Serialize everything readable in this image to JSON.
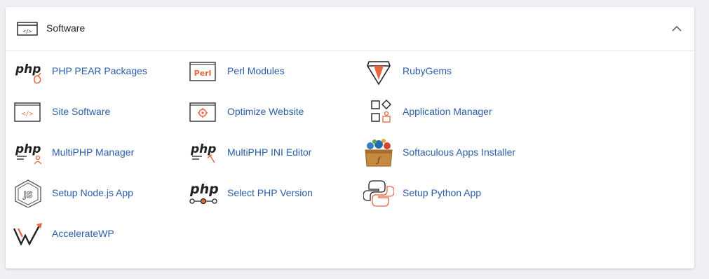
{
  "section": {
    "title": "Software",
    "items": [
      {
        "label": "PHP PEAR Packages",
        "icon": "php-pear-icon"
      },
      {
        "label": "Perl Modules",
        "icon": "perl-icon"
      },
      {
        "label": "RubyGems",
        "icon": "rubygems-icon"
      },
      {
        "label": "Site Software",
        "icon": "code-window-icon"
      },
      {
        "label": "Optimize Website",
        "icon": "gear-window-icon"
      },
      {
        "label": "Application Manager",
        "icon": "app-shapes-icon"
      },
      {
        "label": "MultiPHP Manager",
        "icon": "php-user-icon"
      },
      {
        "label": "MultiPHP INI Editor",
        "icon": "php-edit-icon"
      },
      {
        "label": "Softaculous Apps Installer",
        "icon": "softaculous-box-icon"
      },
      {
        "label": "Setup Node.js App",
        "icon": "nodejs-icon"
      },
      {
        "label": "Select PHP Version",
        "icon": "php-slider-icon"
      },
      {
        "label": "Setup Python App",
        "icon": "python-icon"
      },
      {
        "label": "AccelerateWP",
        "icon": "acceleratewp-icon"
      }
    ],
    "icon_texts": {
      "php": "php",
      "perl": "Perl",
      "js": "JS"
    }
  },
  "colors": {
    "accent": "#e8663d",
    "link": "#2a5ea8",
    "dark": "#222222"
  }
}
